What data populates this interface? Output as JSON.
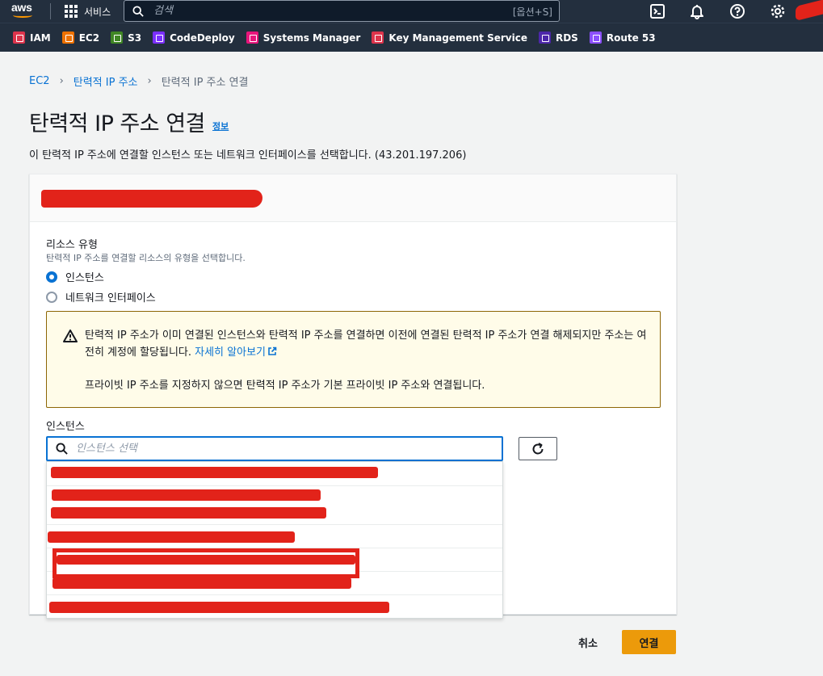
{
  "topnav": {
    "logo_text": "aws",
    "services_label": "서비스",
    "search_placeholder": "검색",
    "search_hint": "[옵션+S]"
  },
  "favorites": [
    {
      "label": "IAM",
      "color": "#dd344c"
    },
    {
      "label": "EC2",
      "color": "#ed7100"
    },
    {
      "label": "S3",
      "color": "#3f8624"
    },
    {
      "label": "CodeDeploy",
      "color": "#7b2fff"
    },
    {
      "label": "Systems Manager",
      "color": "#e7157b"
    },
    {
      "label": "Key Management Service",
      "color": "#dd344c"
    },
    {
      "label": "RDS",
      "color": "#4d27aa"
    },
    {
      "label": "Route 53",
      "color": "#8c4fff"
    }
  ],
  "breadcrumb": {
    "ec2": "EC2",
    "eip": "탄력적 IP 주소",
    "current": "탄력적 IP 주소 연결"
  },
  "page": {
    "title": "탄력적 IP 주소 연결",
    "info": "정보",
    "description": "이 탄력적 IP 주소에 연결할 인스턴스 또는 네트워크 인터페이스를 선택합니다. (43.201.197.206)"
  },
  "resource_type": {
    "label": "리소스 유형",
    "description": "탄력적 IP 주소를 연결할 리소스의 유형을 선택합니다.",
    "options": [
      {
        "label": "인스턴스",
        "selected": true
      },
      {
        "label": "네트워크 인터페이스",
        "selected": false
      }
    ]
  },
  "alert": {
    "text1": "탄력적 IP 주소가 이미 연결된 인스턴스와 탄력적 IP 주소를 연결하면 이전에 연결된 탄력적 IP 주소가 연결 해제되지만 주소는 여전히 계정에 할당됩니다.",
    "link": "자세히 알아보기",
    "text2": "프라이빗 IP 주소를 지정하지 않으면 탄력적 IP 주소가 기본 프라이빗 IP 주소와 연결됩니다."
  },
  "instance": {
    "label": "인스턴스",
    "placeholder": "인스턴스 선택"
  },
  "buttons": {
    "cancel": "취소",
    "connect": "연결"
  },
  "colors": {
    "nav_bg": "#232f3e",
    "link": "#0972d3",
    "primary_button": "#ec9a0a",
    "redaction": "#e2231a"
  }
}
